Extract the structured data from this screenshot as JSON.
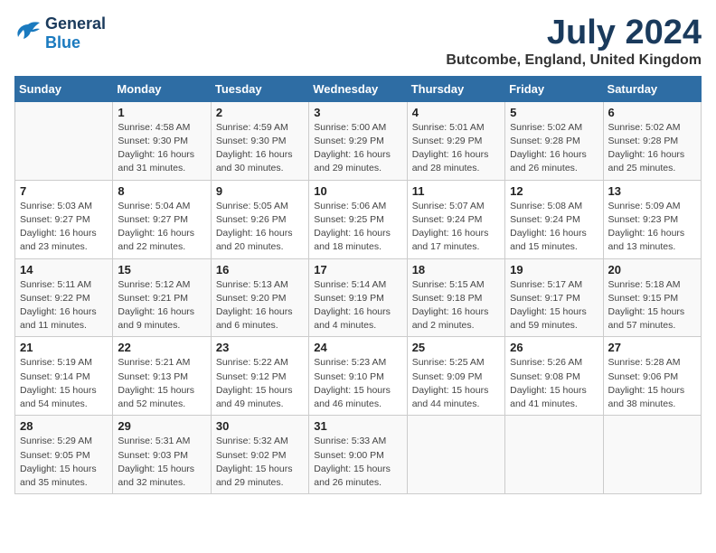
{
  "header": {
    "logo_line1": "General",
    "logo_line2": "Blue",
    "month": "July 2024",
    "location": "Butcombe, England, United Kingdom"
  },
  "columns": [
    "Sunday",
    "Monday",
    "Tuesday",
    "Wednesday",
    "Thursday",
    "Friday",
    "Saturday"
  ],
  "weeks": [
    [
      {
        "day": "",
        "info": ""
      },
      {
        "day": "1",
        "info": "Sunrise: 4:58 AM\nSunset: 9:30 PM\nDaylight: 16 hours\nand 31 minutes."
      },
      {
        "day": "2",
        "info": "Sunrise: 4:59 AM\nSunset: 9:30 PM\nDaylight: 16 hours\nand 30 minutes."
      },
      {
        "day": "3",
        "info": "Sunrise: 5:00 AM\nSunset: 9:29 PM\nDaylight: 16 hours\nand 29 minutes."
      },
      {
        "day": "4",
        "info": "Sunrise: 5:01 AM\nSunset: 9:29 PM\nDaylight: 16 hours\nand 28 minutes."
      },
      {
        "day": "5",
        "info": "Sunrise: 5:02 AM\nSunset: 9:28 PM\nDaylight: 16 hours\nand 26 minutes."
      },
      {
        "day": "6",
        "info": "Sunrise: 5:02 AM\nSunset: 9:28 PM\nDaylight: 16 hours\nand 25 minutes."
      }
    ],
    [
      {
        "day": "7",
        "info": "Sunrise: 5:03 AM\nSunset: 9:27 PM\nDaylight: 16 hours\nand 23 minutes."
      },
      {
        "day": "8",
        "info": "Sunrise: 5:04 AM\nSunset: 9:27 PM\nDaylight: 16 hours\nand 22 minutes."
      },
      {
        "day": "9",
        "info": "Sunrise: 5:05 AM\nSunset: 9:26 PM\nDaylight: 16 hours\nand 20 minutes."
      },
      {
        "day": "10",
        "info": "Sunrise: 5:06 AM\nSunset: 9:25 PM\nDaylight: 16 hours\nand 18 minutes."
      },
      {
        "day": "11",
        "info": "Sunrise: 5:07 AM\nSunset: 9:24 PM\nDaylight: 16 hours\nand 17 minutes."
      },
      {
        "day": "12",
        "info": "Sunrise: 5:08 AM\nSunset: 9:24 PM\nDaylight: 16 hours\nand 15 minutes."
      },
      {
        "day": "13",
        "info": "Sunrise: 5:09 AM\nSunset: 9:23 PM\nDaylight: 16 hours\nand 13 minutes."
      }
    ],
    [
      {
        "day": "14",
        "info": "Sunrise: 5:11 AM\nSunset: 9:22 PM\nDaylight: 16 hours\nand 11 minutes."
      },
      {
        "day": "15",
        "info": "Sunrise: 5:12 AM\nSunset: 9:21 PM\nDaylight: 16 hours\nand 9 minutes."
      },
      {
        "day": "16",
        "info": "Sunrise: 5:13 AM\nSunset: 9:20 PM\nDaylight: 16 hours\nand 6 minutes."
      },
      {
        "day": "17",
        "info": "Sunrise: 5:14 AM\nSunset: 9:19 PM\nDaylight: 16 hours\nand 4 minutes."
      },
      {
        "day": "18",
        "info": "Sunrise: 5:15 AM\nSunset: 9:18 PM\nDaylight: 16 hours\nand 2 minutes."
      },
      {
        "day": "19",
        "info": "Sunrise: 5:17 AM\nSunset: 9:17 PM\nDaylight: 15 hours\nand 59 minutes."
      },
      {
        "day": "20",
        "info": "Sunrise: 5:18 AM\nSunset: 9:15 PM\nDaylight: 15 hours\nand 57 minutes."
      }
    ],
    [
      {
        "day": "21",
        "info": "Sunrise: 5:19 AM\nSunset: 9:14 PM\nDaylight: 15 hours\nand 54 minutes."
      },
      {
        "day": "22",
        "info": "Sunrise: 5:21 AM\nSunset: 9:13 PM\nDaylight: 15 hours\nand 52 minutes."
      },
      {
        "day": "23",
        "info": "Sunrise: 5:22 AM\nSunset: 9:12 PM\nDaylight: 15 hours\nand 49 minutes."
      },
      {
        "day": "24",
        "info": "Sunrise: 5:23 AM\nSunset: 9:10 PM\nDaylight: 15 hours\nand 46 minutes."
      },
      {
        "day": "25",
        "info": "Sunrise: 5:25 AM\nSunset: 9:09 PM\nDaylight: 15 hours\nand 44 minutes."
      },
      {
        "day": "26",
        "info": "Sunrise: 5:26 AM\nSunset: 9:08 PM\nDaylight: 15 hours\nand 41 minutes."
      },
      {
        "day": "27",
        "info": "Sunrise: 5:28 AM\nSunset: 9:06 PM\nDaylight: 15 hours\nand 38 minutes."
      }
    ],
    [
      {
        "day": "28",
        "info": "Sunrise: 5:29 AM\nSunset: 9:05 PM\nDaylight: 15 hours\nand 35 minutes."
      },
      {
        "day": "29",
        "info": "Sunrise: 5:31 AM\nSunset: 9:03 PM\nDaylight: 15 hours\nand 32 minutes."
      },
      {
        "day": "30",
        "info": "Sunrise: 5:32 AM\nSunset: 9:02 PM\nDaylight: 15 hours\nand 29 minutes."
      },
      {
        "day": "31",
        "info": "Sunrise: 5:33 AM\nSunset: 9:00 PM\nDaylight: 15 hours\nand 26 minutes."
      },
      {
        "day": "",
        "info": ""
      },
      {
        "day": "",
        "info": ""
      },
      {
        "day": "",
        "info": ""
      }
    ]
  ]
}
